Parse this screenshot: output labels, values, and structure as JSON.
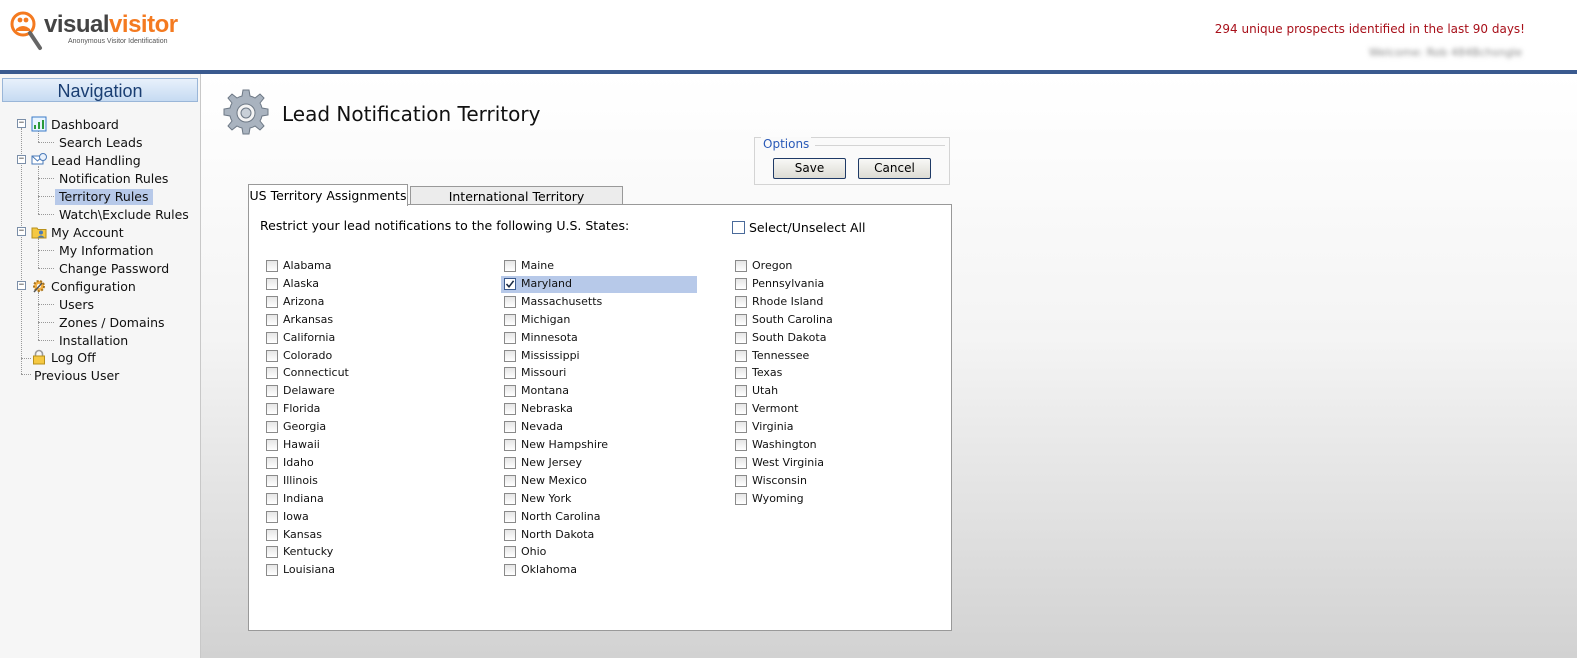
{
  "header": {
    "logo_part1": "visual",
    "logo_part2": "visitor",
    "logo_tagline": "Anonymous Visitor Identification",
    "prospects_text": "294 unique prospects identified in the last 90 days!",
    "welcome_text": "Welcome: Rob 484Bchsngle"
  },
  "nav": {
    "title": "Navigation",
    "items": [
      {
        "label": "Dashboard"
      },
      {
        "label": "Search Leads"
      },
      {
        "label": "Lead Handling"
      },
      {
        "label": "Notification Rules"
      },
      {
        "label": "Territory Rules"
      },
      {
        "label": "Watch\\Exclude Rules"
      },
      {
        "label": "My Account"
      },
      {
        "label": "My Information"
      },
      {
        "label": "Change Password"
      },
      {
        "label": "Configuration"
      },
      {
        "label": "Users"
      },
      {
        "label": "Zones / Domains"
      },
      {
        "label": "Installation"
      },
      {
        "label": "Log Off"
      },
      {
        "label": "Previous User"
      }
    ],
    "selected": "Territory Rules"
  },
  "page": {
    "title": "Lead Notification Territory"
  },
  "options": {
    "legend": "Options",
    "save_label": "Save",
    "cancel_label": "Cancel"
  },
  "tabs": {
    "us": "US Territory Assignments",
    "international": "International Territory Assignments"
  },
  "panel": {
    "restrict_label": "Restrict your lead notifications to the following U.S. States:",
    "select_all_label": "Select/Unselect All"
  },
  "states": {
    "col1": [
      "Alabama",
      "Alaska",
      "Arizona",
      "Arkansas",
      "California",
      "Colorado",
      "Connecticut",
      "Delaware",
      "Florida",
      "Georgia",
      "Hawaii",
      "Idaho",
      "Illinois",
      "Indiana",
      "Iowa",
      "Kansas",
      "Kentucky",
      "Louisiana"
    ],
    "col2": [
      "Maine",
      "Maryland",
      "Massachusetts",
      "Michigan",
      "Minnesota",
      "Mississippi",
      "Missouri",
      "Montana",
      "Nebraska",
      "Nevada",
      "New Hampshire",
      "New Jersey",
      "New Mexico",
      "New York",
      "North Carolina",
      "North Dakota",
      "Ohio",
      "Oklahoma"
    ],
    "col3": [
      "Oregon",
      "Pennsylvania",
      "Rhode Island",
      "South Carolina",
      "South Dakota",
      "Tennessee",
      "Texas",
      "Utah",
      "Vermont",
      "Virginia",
      "Washington",
      "West Virginia",
      "Wisconsin",
      "Wyoming"
    ],
    "checked": [
      "Maryland"
    ]
  },
  "colors": {
    "header_bar": "#3a5a8f",
    "prospects_text": "#a8101a",
    "selection": "#b7c9e9",
    "logo_orange": "#f47a20"
  }
}
